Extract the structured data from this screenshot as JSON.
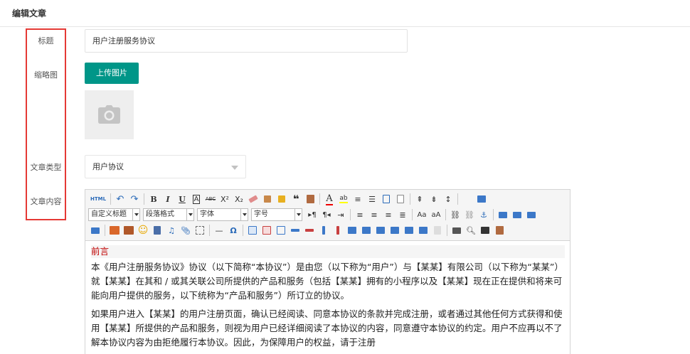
{
  "page": {
    "title": "编辑文章"
  },
  "form": {
    "labels": {
      "title": "标题",
      "thumbnail": "缩略图",
      "type": "文章类型",
      "content": "文章内容"
    },
    "title_value": "用户注册服务协议",
    "upload_label": "上传图片",
    "type_value": "用户协议"
  },
  "toolbar": {
    "source": "HTML",
    "custom_title": "自定义标题",
    "paragraph": "段落格式",
    "font": "字体",
    "size": "字号",
    "bold": "B",
    "italic": "I",
    "underline": "U",
    "font_border": "A",
    "strike": "ABC",
    "omega": "Ω"
  },
  "editor": {
    "preface": "前言",
    "paragraphs": [
      "本《用户注册服务协议》协议（以下简称“本协议”）是由您（以下称为“用户”）与【某某】有限公司（以下称为“某某”）就【某某】在其和 / 或其关联公司所提供的产品和服务（包括【某某】拥有的小程序以及【某某】现在正在提供和将来可能向用户提供的服务，以下统称为“产品和服务”）所订立的协议。",
      "如果用户进入【某某】的用户注册页面，确认已经阅读、同意本协议的条款并完成注册，或者通过其他任何方式获得和使用【某某】所提供的产品和服务，则视为用户已经详细阅读了本协议的内容，同意遵守本协议的约定。用户不应再以不了解本协议内容为由拒绝履行本协议。因此，为保障用户的权益，请于注册"
    ]
  },
  "colors": {
    "accent": "#009688",
    "highlight_border": "#e53935",
    "preface_red": "#c00000"
  }
}
